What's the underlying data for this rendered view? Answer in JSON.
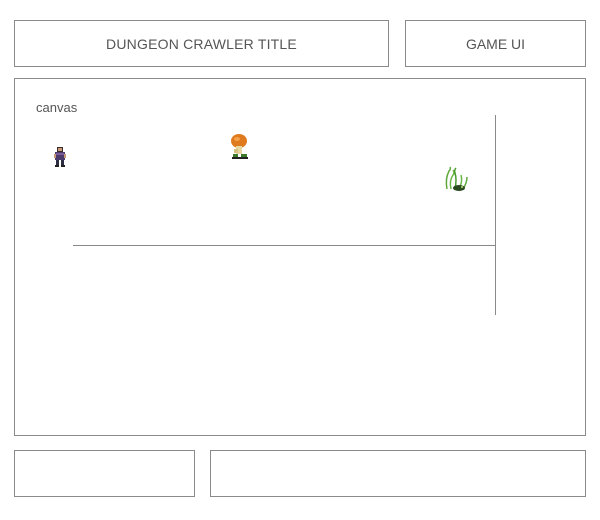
{
  "header": {
    "title": "DUNGEON CRAWLER TITLE",
    "game_ui_label": "GAME UI"
  },
  "canvas": {
    "label": "canvas",
    "sprites": [
      {
        "name": "player",
        "icon": "player-character-sprite"
      },
      {
        "name": "mushroom",
        "icon": "mushroom-creature-sprite"
      },
      {
        "name": "plant",
        "icon": "tentacle-plant-sprite"
      }
    ]
  },
  "footer": {
    "left_text": "",
    "right_text": ""
  },
  "colors": {
    "border": "#8a8a8a",
    "text": "#555555",
    "background": "#ffffff"
  }
}
